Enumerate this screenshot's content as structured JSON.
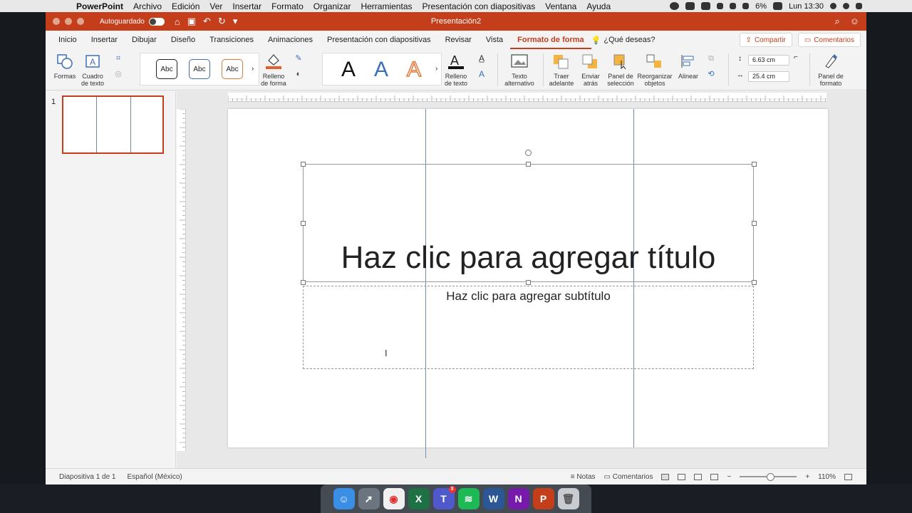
{
  "menubar": {
    "app_name": "PowerPoint",
    "items": [
      "Archivo",
      "Edición",
      "Ver",
      "Insertar",
      "Formato",
      "Organizar",
      "Herramientas",
      "Presentación con diapositivas",
      "Ventana",
      "Ayuda"
    ],
    "battery": "6%",
    "clock": "Lun 13:30"
  },
  "titlebar": {
    "autosave_label": "Autoguardado",
    "doc_title": "Presentación2"
  },
  "tabs": [
    "Inicio",
    "Insertar",
    "Dibujar",
    "Diseño",
    "Transiciones",
    "Animaciones",
    "Presentación con diapositivas",
    "Revisar",
    "Vista",
    "Formato de forma"
  ],
  "active_tab": "Formato de forma",
  "tell_me": "¿Qué deseas?",
  "share_label": "Compartir",
  "comments_label": "Comentarios",
  "ribbon": {
    "formas": "Formas",
    "cuadro_texto_1": "Cuadro",
    "cuadro_texto_2": "de texto",
    "style_abc": "Abc",
    "relleno_forma_1": "Relleno",
    "relleno_forma_2": "de forma",
    "wordart_a": "A",
    "relleno_texto_1": "Relleno",
    "relleno_texto_2": "de texto",
    "texto_alt_1": "Texto",
    "texto_alt_2": "alternativo",
    "traer_1": "Traer",
    "traer_2": "adelante",
    "enviar_1": "Enviar",
    "enviar_2": "atrás",
    "panel_sel_1": "Panel de",
    "panel_sel_2": "selección",
    "reorg_1": "Reorganizar",
    "reorg_2": "objetos",
    "alinear": "Alinear",
    "height": "6.63 cm",
    "width": "25.4 cm",
    "panel_fmt_1": "Panel de",
    "panel_fmt_2": "formato"
  },
  "slide_pane": {
    "slide_number": "1"
  },
  "slide": {
    "title_placeholder": "Haz clic para agregar título",
    "subtitle_placeholder": "Haz clic para agregar subtítulo"
  },
  "status": {
    "slide_count": "Diapositiva 1 de 1",
    "language": "Español (México)",
    "notes": "Notas",
    "comments": "Comentarios",
    "zoom": "110%"
  },
  "dock": {
    "teams_badge": "3"
  },
  "colors": {
    "accent": "#c43e1c",
    "guide": "#6f8fb0"
  }
}
